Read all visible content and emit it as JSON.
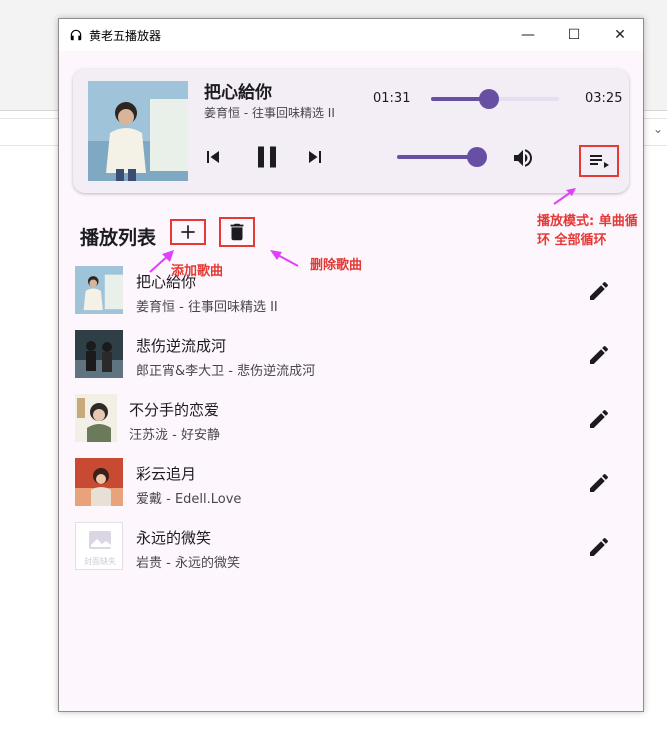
{
  "window": {
    "title": "黄老五播放器",
    "controls": {
      "minimize": "—",
      "maximize": "☐",
      "close": "✕"
    }
  },
  "player": {
    "title": "把心給你",
    "subtitle": "姜育恒 - 往事回味精选 II",
    "current_time": "01:31",
    "total_time": "03:25",
    "progress_fraction": 0.45,
    "volume_fraction": 1.0,
    "icons": {
      "prev": "skip-previous-icon",
      "play_pause": "pause-icon",
      "next": "skip-next-icon",
      "volume": "volume-up-icon",
      "mode": "playlist-play-icon"
    }
  },
  "playlist": {
    "title": "播放列表",
    "add_icon": "add-icon",
    "delete_icon": "delete-icon",
    "items": [
      {
        "title": "把心給你",
        "subtitle": "姜育恒 - 往事回味精选 II"
      },
      {
        "title": "悲伤逆流成河",
        "subtitle": "郎正宵&李大卫 - 悲伤逆流成河"
      },
      {
        "title": "不分手的恋爱",
        "subtitle": "汪苏泷 - 好安静"
      },
      {
        "title": "彩云追月",
        "subtitle": "爱戴 - Edell.Love"
      },
      {
        "title": "永远的微笑",
        "subtitle": "岩贵 - 永远的微笑",
        "cover_placeholder": "封面缺失"
      }
    ]
  },
  "annotations": {
    "mode_note_line1": "播放模式: 单曲循",
    "mode_note_line2": "环 全部循环",
    "add_note": "添加歌曲",
    "delete_note": "删除歌曲",
    "color": "#e53935"
  },
  "colors": {
    "accent": "#6750a4",
    "window_bg": "#fdf7fd",
    "card_bg": "#f3edf5"
  }
}
